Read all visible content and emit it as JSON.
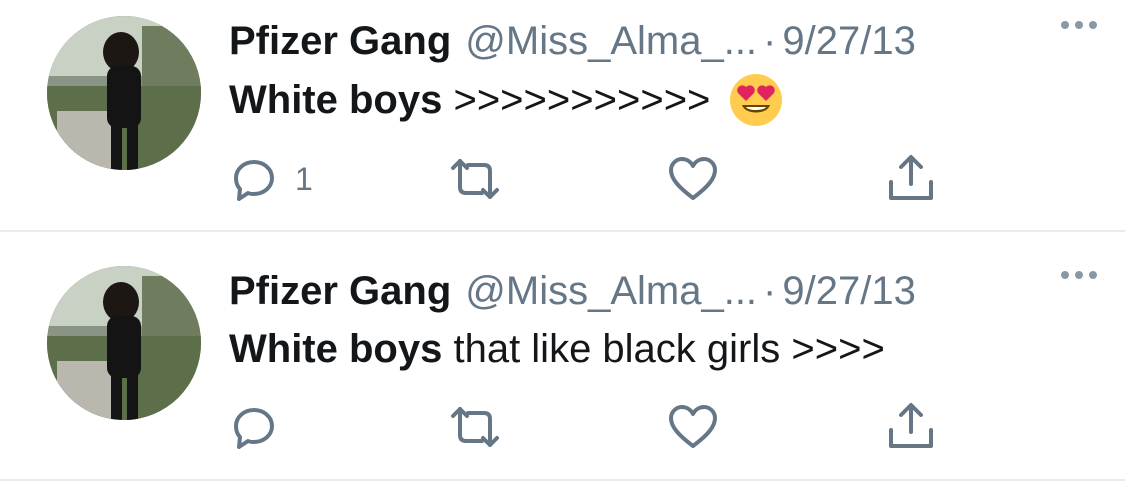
{
  "tweets": [
    {
      "display_name": "Pfizer Gang",
      "handle": "@Miss_Alma_...",
      "separator": "·",
      "date": "9/27/13",
      "text_bold": "White boys",
      "text_rest": " >>>>>>>>>>>",
      "emoji": "heart-eyes-emoji",
      "reply_count": "1",
      "icons": [
        "reply-icon",
        "retweet-icon",
        "like-icon",
        "share-icon",
        "more-icon"
      ]
    },
    {
      "display_name": "Pfizer Gang",
      "handle": "@Miss_Alma_...",
      "separator": "·",
      "date": "9/27/13",
      "text_bold": "White boys",
      "text_rest": " that like black girls >>>>",
      "reply_count": "",
      "icons": [
        "reply-icon",
        "retweet-icon",
        "like-icon",
        "share-icon",
        "more-icon"
      ]
    }
  ],
  "colors": {
    "text": "#14171a",
    "secondary": "#657786",
    "divider": "#e6ecf0",
    "emoji_face": "#ffcc4d",
    "emoji_heart": "#e0245e"
  }
}
